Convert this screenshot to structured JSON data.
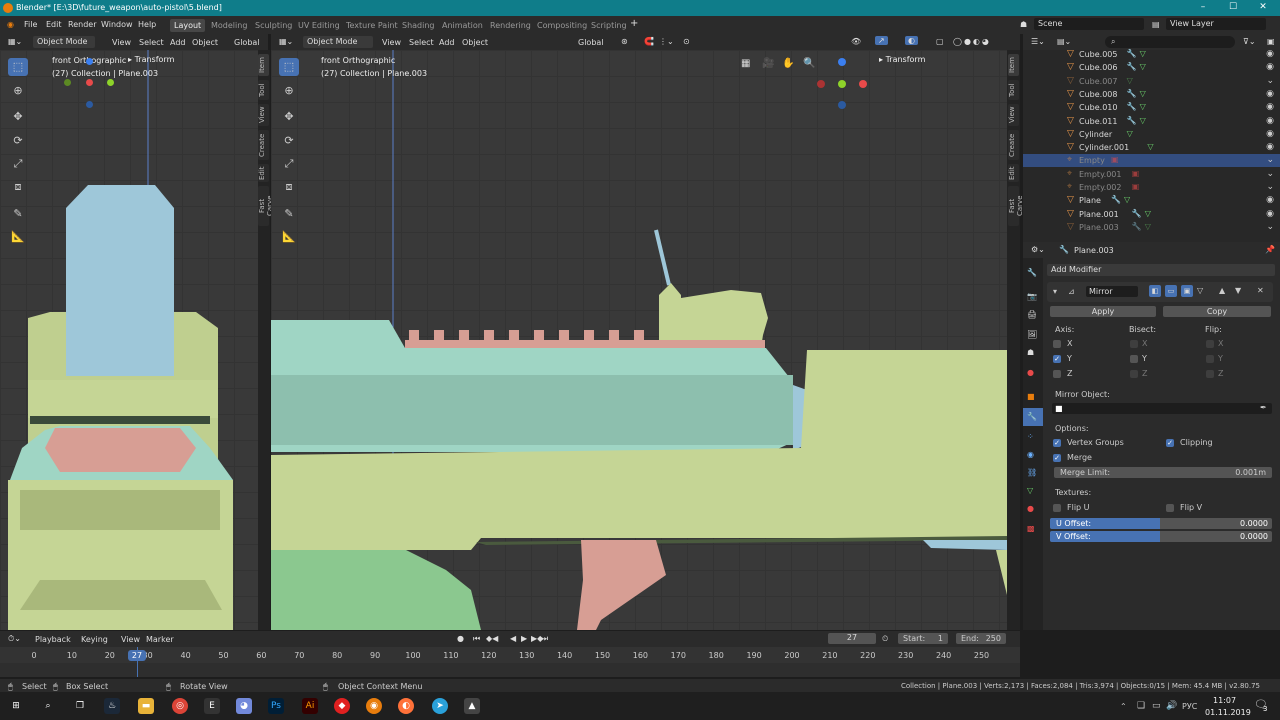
{
  "window": {
    "title": "Blender* [E:\\3D\\future_weapon\\auto-pistol\\5.blend]",
    "min": "–",
    "max": "☐",
    "close": "✕"
  },
  "menu": {
    "items": [
      "File",
      "Edit",
      "Render",
      "Window",
      "Help"
    ],
    "workspaces": [
      "Layout",
      "Modeling",
      "Sculpting",
      "UV Editing",
      "Texture Paint",
      "Shading",
      "Animation",
      "Rendering",
      "Compositing",
      "Scripting"
    ],
    "add_tab": "+",
    "scene_label": "Scene",
    "view_layer": "View Layer"
  },
  "left_view": {
    "mode": "Object Mode",
    "menus": [
      "View",
      "Select",
      "Add",
      "Object"
    ],
    "orient": "Global",
    "overlay_title": "front Orthographic",
    "collection_info": "(27) Collection | Plane.003",
    "transform": "Transform"
  },
  "main_view": {
    "mode": "Object Mode",
    "menus": [
      "View",
      "Select",
      "Add",
      "Object"
    ],
    "orient": "Global",
    "overlay_title": "front Orthographic",
    "collection_info": "(27) Collection | Plane.003",
    "transform": "Transform"
  },
  "side_tabs": [
    "Item",
    "Tool",
    "View",
    "Create",
    "Edit",
    "Fast Carve"
  ],
  "outliner": {
    "rows": [
      {
        "name": "Cube.005",
        "dim": false,
        "mod": true,
        "mesh": true
      },
      {
        "name": "Cube.006",
        "dim": false,
        "mod": true,
        "mesh": true
      },
      {
        "name": "Cube.007",
        "dim": true,
        "mod": false,
        "mesh": true
      },
      {
        "name": "Cube.008",
        "dim": false,
        "mod": true,
        "mesh": true
      },
      {
        "name": "Cube.010",
        "dim": false,
        "mod": true,
        "mesh": true
      },
      {
        "name": "Cube.011",
        "dim": false,
        "mod": true,
        "mesh": true
      },
      {
        "name": "Cylinder",
        "dim": false,
        "mod": false,
        "mesh": true
      },
      {
        "name": "Cylinder.001",
        "dim": false,
        "mod": false,
        "mesh": true
      },
      {
        "name": "Empty",
        "dim": true,
        "mod": false,
        "mesh": false,
        "selected": true
      },
      {
        "name": "Empty.001",
        "dim": true,
        "mod": false,
        "mesh": false
      },
      {
        "name": "Empty.002",
        "dim": true,
        "mod": false,
        "mesh": false
      },
      {
        "name": "Plane",
        "dim": false,
        "mod": true,
        "mesh": true
      },
      {
        "name": "Plane.001",
        "dim": false,
        "mod": true,
        "mesh": true
      },
      {
        "name": "Plane.003",
        "dim": true,
        "mod": true,
        "mesh": true
      }
    ],
    "search_placeholder": ""
  },
  "properties": {
    "object_name": "Plane.003",
    "add_modifier": "Add Modifier",
    "modifier_name": "Mirror",
    "apply": "Apply",
    "copy": "Copy",
    "axis_label": "Axis:",
    "bisect_label": "Bisect:",
    "flip_label": "Flip:",
    "axes": [
      "X",
      "Y",
      "Z"
    ],
    "mirror_object": "Mirror Object:",
    "options": "Options:",
    "vertex_groups": "Vertex Groups",
    "clipping": "Clipping",
    "merge": "Merge",
    "merge_limit_label": "Merge Limit:",
    "merge_limit": "0.001m",
    "textures": "Textures:",
    "flip_u": "Flip U",
    "flip_v": "Flip V",
    "u_offset_label": "U Offset:",
    "u_offset": "0.0000",
    "v_offset_label": "V Offset:",
    "v_offset": "0.0000"
  },
  "timeline": {
    "menus": [
      "Playback",
      "Keying",
      "View",
      "Marker"
    ],
    "current": "27",
    "start_label": "Start:",
    "start": "1",
    "end_label": "End:",
    "end": "250",
    "ticks": [
      "0",
      "10",
      "20",
      "30",
      "40",
      "50",
      "60",
      "70",
      "80",
      "90",
      "100",
      "110",
      "120",
      "130",
      "140",
      "150",
      "160",
      "170",
      "180",
      "190",
      "200",
      "210",
      "220",
      "230",
      "240",
      "250"
    ],
    "current_marker": "27"
  },
  "statusbar": {
    "select": "Select",
    "box_select": "Box Select",
    "rotate_view": "Rotate View",
    "context_menu": "Object Context Menu",
    "stats": "Collection | Plane.003 | Verts:2,173 | Faces:2,084 | Tris:3,974 | Objects:0/15 | Mem: 45.4 MB | v2.80.75"
  },
  "taskbar": {
    "time": "11:07",
    "date": "01.11.2019",
    "lang": "РУС",
    "notif": "3"
  },
  "colors": {
    "accent": "#4772b3",
    "titlebar": "#0f7d8a",
    "green_obj": "#c5d595",
    "teal_obj": "#9fd5c4",
    "blue_obj": "#9ec7d9",
    "pink_obj": "#d79e94"
  }
}
